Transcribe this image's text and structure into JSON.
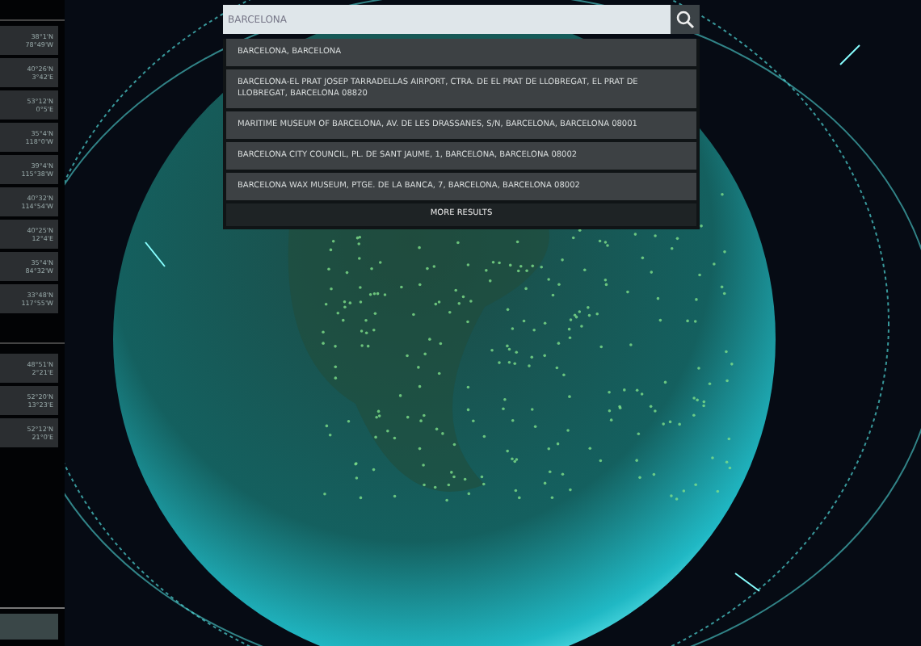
{
  "sidebar": {
    "groups": [
      {
        "items": [
          {
            "lat": "38°1'N",
            "lon": "78°49'W"
          },
          {
            "lat": "40°26'N",
            "lon": "3°42'E"
          },
          {
            "lat": "53°12'N",
            "lon": "0°5'E"
          },
          {
            "lat": "35°4'N",
            "lon": "118°0'W"
          },
          {
            "lat": "39°4'N",
            "lon": "115°38'W"
          },
          {
            "lat": "40°32'N",
            "lon": "114°54'W"
          },
          {
            "lat": "40°25'N",
            "lon": "12°4'E"
          },
          {
            "lat": "35°4'N",
            "lon": "84°32'W"
          },
          {
            "lat": "33°48'N",
            "lon": "117°55'W"
          }
        ]
      },
      {
        "items": [
          {
            "lat": "48°51'N",
            "lon": "2°21'E"
          },
          {
            "lat": "52°20'N",
            "lon": "13°23'E"
          },
          {
            "lat": "52°12'N",
            "lon": "21°0'E"
          }
        ]
      }
    ]
  },
  "search": {
    "value": "BARCELONA"
  },
  "results": [
    "BARCELONA, BARCELONA",
    "BARCELONA-EL PRAT JOSEP TARRADELLAS AIRPORT, CTRA. DE EL PRAT DE LLOBREGAT, EL PRAT DE LLOBREGAT, BARCELONA 08820",
    "MARITIME MUSEUM OF BARCELONA, AV. DE LES DRASSANES, S/N, BARCELONA, BARCELONA 08001",
    "BARCELONA CITY COUNCIL, PL. DE SANT JAUME, 1, BARCELONA, BARCELONA 08002",
    "BARCELONA WAX MUSEUM, PTGE. DE LA BANCA, 7, BARCELONA, BARCELONA 08002"
  ],
  "more_results": "MORE RESULTS"
}
